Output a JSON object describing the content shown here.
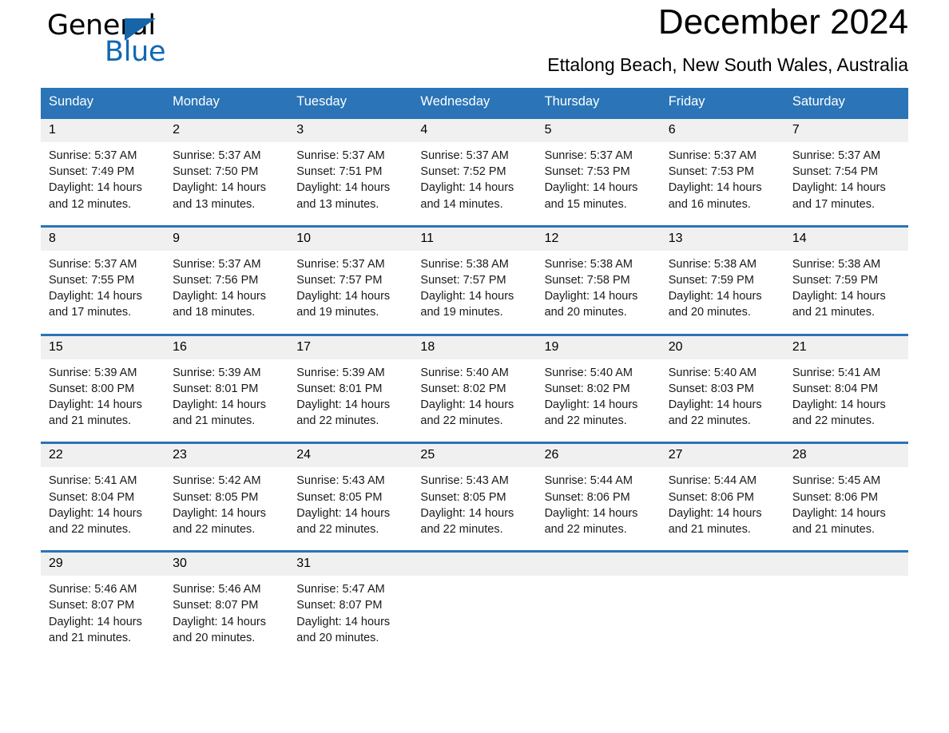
{
  "brand": {
    "name_part1": "General",
    "name_part2": "Blue",
    "triangle_color": "#1565a8",
    "blue_color": "#1268b3"
  },
  "header": {
    "month_title": "December 2024",
    "location": "Ettalong Beach, New South Wales, Australia"
  },
  "theme": {
    "header_blue": "#2a74b7",
    "daynum_band": "#f0f0f0",
    "text": "#000000"
  },
  "calendar": {
    "weekday_headers": [
      "Sunday",
      "Monday",
      "Tuesday",
      "Wednesday",
      "Thursday",
      "Friday",
      "Saturday"
    ],
    "weeks": [
      [
        {
          "day": "1",
          "sunrise": "Sunrise: 5:37 AM",
          "sunset": "Sunset: 7:49 PM",
          "daylight": "Daylight: 14 hours and 12 minutes."
        },
        {
          "day": "2",
          "sunrise": "Sunrise: 5:37 AM",
          "sunset": "Sunset: 7:50 PM",
          "daylight": "Daylight: 14 hours and 13 minutes."
        },
        {
          "day": "3",
          "sunrise": "Sunrise: 5:37 AM",
          "sunset": "Sunset: 7:51 PM",
          "daylight": "Daylight: 14 hours and 13 minutes."
        },
        {
          "day": "4",
          "sunrise": "Sunrise: 5:37 AM",
          "sunset": "Sunset: 7:52 PM",
          "daylight": "Daylight: 14 hours and 14 minutes."
        },
        {
          "day": "5",
          "sunrise": "Sunrise: 5:37 AM",
          "sunset": "Sunset: 7:53 PM",
          "daylight": "Daylight: 14 hours and 15 minutes."
        },
        {
          "day": "6",
          "sunrise": "Sunrise: 5:37 AM",
          "sunset": "Sunset: 7:53 PM",
          "daylight": "Daylight: 14 hours and 16 minutes."
        },
        {
          "day": "7",
          "sunrise": "Sunrise: 5:37 AM",
          "sunset": "Sunset: 7:54 PM",
          "daylight": "Daylight: 14 hours and 17 minutes."
        }
      ],
      [
        {
          "day": "8",
          "sunrise": "Sunrise: 5:37 AM",
          "sunset": "Sunset: 7:55 PM",
          "daylight": "Daylight: 14 hours and 17 minutes."
        },
        {
          "day": "9",
          "sunrise": "Sunrise: 5:37 AM",
          "sunset": "Sunset: 7:56 PM",
          "daylight": "Daylight: 14 hours and 18 minutes."
        },
        {
          "day": "10",
          "sunrise": "Sunrise: 5:37 AM",
          "sunset": "Sunset: 7:57 PM",
          "daylight": "Daylight: 14 hours and 19 minutes."
        },
        {
          "day": "11",
          "sunrise": "Sunrise: 5:38 AM",
          "sunset": "Sunset: 7:57 PM",
          "daylight": "Daylight: 14 hours and 19 minutes."
        },
        {
          "day": "12",
          "sunrise": "Sunrise: 5:38 AM",
          "sunset": "Sunset: 7:58 PM",
          "daylight": "Daylight: 14 hours and 20 minutes."
        },
        {
          "day": "13",
          "sunrise": "Sunrise: 5:38 AM",
          "sunset": "Sunset: 7:59 PM",
          "daylight": "Daylight: 14 hours and 20 minutes."
        },
        {
          "day": "14",
          "sunrise": "Sunrise: 5:38 AM",
          "sunset": "Sunset: 7:59 PM",
          "daylight": "Daylight: 14 hours and 21 minutes."
        }
      ],
      [
        {
          "day": "15",
          "sunrise": "Sunrise: 5:39 AM",
          "sunset": "Sunset: 8:00 PM",
          "daylight": "Daylight: 14 hours and 21 minutes."
        },
        {
          "day": "16",
          "sunrise": "Sunrise: 5:39 AM",
          "sunset": "Sunset: 8:01 PM",
          "daylight": "Daylight: 14 hours and 21 minutes."
        },
        {
          "day": "17",
          "sunrise": "Sunrise: 5:39 AM",
          "sunset": "Sunset: 8:01 PM",
          "daylight": "Daylight: 14 hours and 22 minutes."
        },
        {
          "day": "18",
          "sunrise": "Sunrise: 5:40 AM",
          "sunset": "Sunset: 8:02 PM",
          "daylight": "Daylight: 14 hours and 22 minutes."
        },
        {
          "day": "19",
          "sunrise": "Sunrise: 5:40 AM",
          "sunset": "Sunset: 8:02 PM",
          "daylight": "Daylight: 14 hours and 22 minutes."
        },
        {
          "day": "20",
          "sunrise": "Sunrise: 5:40 AM",
          "sunset": "Sunset: 8:03 PM",
          "daylight": "Daylight: 14 hours and 22 minutes."
        },
        {
          "day": "21",
          "sunrise": "Sunrise: 5:41 AM",
          "sunset": "Sunset: 8:04 PM",
          "daylight": "Daylight: 14 hours and 22 minutes."
        }
      ],
      [
        {
          "day": "22",
          "sunrise": "Sunrise: 5:41 AM",
          "sunset": "Sunset: 8:04 PM",
          "daylight": "Daylight: 14 hours and 22 minutes."
        },
        {
          "day": "23",
          "sunrise": "Sunrise: 5:42 AM",
          "sunset": "Sunset: 8:05 PM",
          "daylight": "Daylight: 14 hours and 22 minutes."
        },
        {
          "day": "24",
          "sunrise": "Sunrise: 5:43 AM",
          "sunset": "Sunset: 8:05 PM",
          "daylight": "Daylight: 14 hours and 22 minutes."
        },
        {
          "day": "25",
          "sunrise": "Sunrise: 5:43 AM",
          "sunset": "Sunset: 8:05 PM",
          "daylight": "Daylight: 14 hours and 22 minutes."
        },
        {
          "day": "26",
          "sunrise": "Sunrise: 5:44 AM",
          "sunset": "Sunset: 8:06 PM",
          "daylight": "Daylight: 14 hours and 22 minutes."
        },
        {
          "day": "27",
          "sunrise": "Sunrise: 5:44 AM",
          "sunset": "Sunset: 8:06 PM",
          "daylight": "Daylight: 14 hours and 21 minutes."
        },
        {
          "day": "28",
          "sunrise": "Sunrise: 5:45 AM",
          "sunset": "Sunset: 8:06 PM",
          "daylight": "Daylight: 14 hours and 21 minutes."
        }
      ],
      [
        {
          "day": "29",
          "sunrise": "Sunrise: 5:46 AM",
          "sunset": "Sunset: 8:07 PM",
          "daylight": "Daylight: 14 hours and 21 minutes."
        },
        {
          "day": "30",
          "sunrise": "Sunrise: 5:46 AM",
          "sunset": "Sunset: 8:07 PM",
          "daylight": "Daylight: 14 hours and 20 minutes."
        },
        {
          "day": "31",
          "sunrise": "Sunrise: 5:47 AM",
          "sunset": "Sunset: 8:07 PM",
          "daylight": "Daylight: 14 hours and 20 minutes."
        },
        {
          "day": "",
          "sunrise": "",
          "sunset": "",
          "daylight": ""
        },
        {
          "day": "",
          "sunrise": "",
          "sunset": "",
          "daylight": ""
        },
        {
          "day": "",
          "sunrise": "",
          "sunset": "",
          "daylight": ""
        },
        {
          "day": "",
          "sunrise": "",
          "sunset": "",
          "daylight": ""
        }
      ]
    ]
  }
}
